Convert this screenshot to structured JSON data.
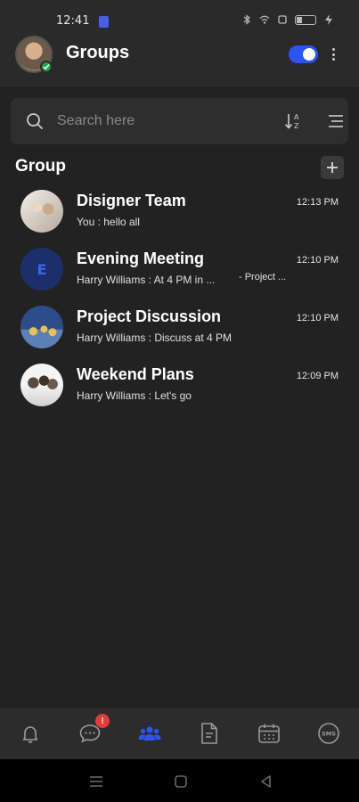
{
  "status_bar": {
    "time": "12:41"
  },
  "header": {
    "title": "Groups",
    "toggle_on": true
  },
  "search": {
    "placeholder": "Search here"
  },
  "section": {
    "title": "Group"
  },
  "groups": [
    {
      "name": "Disigner Team",
      "time": "12:13 PM",
      "last_message": "You : hello all",
      "tag": ""
    },
    {
      "name": "Evening Meeting",
      "time": "12:10 PM",
      "last_message": "Harry Williams : At 4 PM in ...",
      "tag": "- Project ...",
      "initial": "E"
    },
    {
      "name": "Project Discussion",
      "time": "12:10 PM",
      "last_message": "Harry Williams : Discuss at 4 PM",
      "tag": ""
    },
    {
      "name": "Weekend Plans",
      "time": "12:09 PM",
      "last_message": "Harry Williams : Let's go",
      "tag": ""
    }
  ],
  "bottom_nav": {
    "items": [
      {
        "icon": "bell-icon"
      },
      {
        "icon": "chat-icon",
        "badge": "!"
      },
      {
        "icon": "groups-icon",
        "active": true
      },
      {
        "icon": "document-icon"
      },
      {
        "icon": "calendar-icon"
      },
      {
        "icon": "sms-icon",
        "label": "SMS"
      }
    ]
  },
  "colors": {
    "accent": "#2a55f5",
    "background": "#222222",
    "badge": "#e43b3b",
    "online": "#22a54a"
  }
}
